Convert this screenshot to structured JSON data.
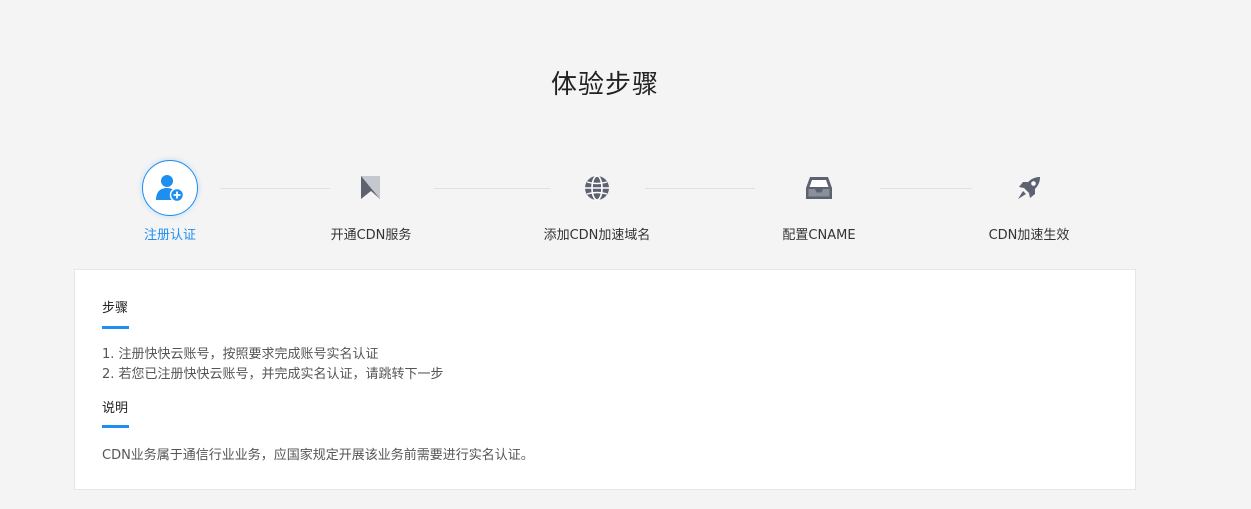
{
  "page": {
    "title": "体验步骤"
  },
  "steps": [
    {
      "label": "注册认证",
      "icon": "add-user-icon",
      "active": true
    },
    {
      "label": "开通CDN服务",
      "icon": "flag-icon",
      "active": false
    },
    {
      "label": "添加CDN加速域名",
      "icon": "globe-icon",
      "active": false
    },
    {
      "label": "配置CNAME",
      "icon": "inbox-icon",
      "active": false
    },
    {
      "label": "CDN加速生效",
      "icon": "rocket-icon",
      "active": false
    }
  ],
  "panel": {
    "steps_title": "步骤",
    "steps_lines": [
      "1. 注册快快云账号，按照要求完成账号实名认证",
      "2. 若您已注册快快云账号，并完成实名认证，请跳转下一步"
    ],
    "notes_title": "说明",
    "notes_text": "CDN业务属于通信行业业务，应国家规定开展该业务前需要进行实名认证。"
  },
  "colors": {
    "accent": "#1f8ef1",
    "icon_gray": "#5c6270",
    "background": "#f4f4f4"
  }
}
